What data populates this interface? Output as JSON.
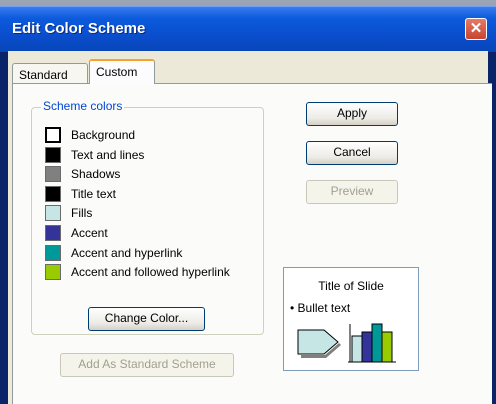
{
  "window": {
    "title": "Edit Color Scheme",
    "close_glyph": "✕"
  },
  "tabs": [
    {
      "label": "Standard",
      "selected": false
    },
    {
      "label": "Custom",
      "selected": true
    }
  ],
  "scheme": {
    "legend": "Scheme colors",
    "items": [
      {
        "label": "Background",
        "color": "#ffffff"
      },
      {
        "label": "Text and lines",
        "color": "#000000"
      },
      {
        "label": "Shadows",
        "color": "#808080"
      },
      {
        "label": "Title text",
        "color": "#000000"
      },
      {
        "label": "Fills",
        "color": "#c6e6e6"
      },
      {
        "label": "Accent",
        "color": "#333399"
      },
      {
        "label": "Accent and hyperlink",
        "color": "#009999"
      },
      {
        "label": "Accent and followed hyperlink",
        "color": "#99cc00"
      }
    ],
    "selected_index": 0
  },
  "buttons": {
    "change_color": "Change Color...",
    "add_standard": "Add As Standard Scheme",
    "apply": "Apply",
    "cancel": "Cancel",
    "preview": "Preview"
  },
  "preview_box": {
    "title": "Title of Slide",
    "bullet": "• Bullet text"
  }
}
